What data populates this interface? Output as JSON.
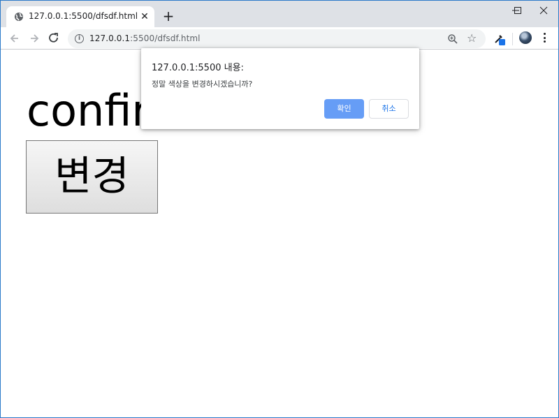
{
  "tab": {
    "title": "127.0.0.1:5500/dfsdf.html",
    "favicon": "globe-icon",
    "close_glyph": "✕",
    "newtab_glyph": "+"
  },
  "toolbar": {
    "url_host": "127.0.0.1",
    "url_rest": ":5500/dfsdf.html",
    "info_glyph": "i",
    "star_glyph": "☆"
  },
  "page": {
    "heading": "confirm",
    "button_label": "변경"
  },
  "dialog": {
    "title": "127.0.0.1:5500 내용:",
    "message": "정말 색상을 변경하시겠습니까?",
    "ok_label": "확인",
    "cancel_label": "취소"
  },
  "colors": {
    "accent": "#669df6",
    "cancel_text": "#1a73e8",
    "tabstrip": "#dee1e6"
  }
}
